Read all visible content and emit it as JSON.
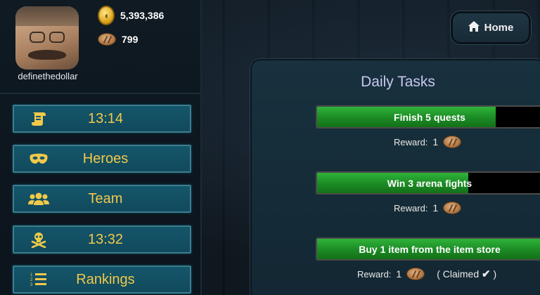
{
  "player": {
    "username": "definethedollar",
    "coins": "5,393,386",
    "bread": "799"
  },
  "menu": [
    {
      "label": "13:14",
      "icon": "scroll-icon"
    },
    {
      "label": "Heroes",
      "icon": "mask-icon"
    },
    {
      "label": "Team",
      "icon": "team-icon"
    },
    {
      "label": "13:32",
      "icon": "skull-crossbones-icon"
    },
    {
      "label": "Rankings",
      "icon": "ranked-list-icon"
    }
  ],
  "home_button": {
    "label": "Home",
    "icon": "home-icon"
  },
  "daily_tasks": {
    "title": "Daily Tasks",
    "reward_label": "Reward:",
    "tasks": [
      {
        "label": "Finish 5 quests",
        "progress": 0.78,
        "reward_amount": "1",
        "claimed": false
      },
      {
        "label": "Win 3 arena fights",
        "progress": 0.66,
        "reward_amount": "1",
        "claimed": false
      },
      {
        "label": "Buy 1 item from the item store",
        "progress": 1.0,
        "reward_amount": "1",
        "claimed": true,
        "claimed_text": "( Claimed",
        "claimed_close": ")"
      }
    ]
  },
  "colors": {
    "menu_text": "#f1c94a",
    "menu_bg": "#15566b",
    "progress_green": "#2fb33a",
    "panel_bg": "#18313e",
    "title_text": "#c7c6ee"
  }
}
